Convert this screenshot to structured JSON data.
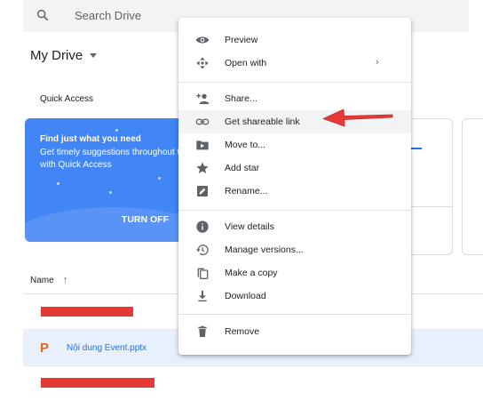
{
  "search": {
    "placeholder": "Search Drive"
  },
  "header": {
    "title": "My Drive"
  },
  "quick_access": {
    "label": "Quick Access",
    "card": {
      "title": "Find just what you need",
      "description": "Get timely suggestions throughout the day with Quick Access",
      "button": "TURN OFF"
    }
  },
  "file_list": {
    "column_name": "Name",
    "sort_icon": "↑",
    "files": [
      {
        "name": "",
        "redacted": true
      },
      {
        "name": "Nội dung Event.pptx",
        "icon": "powerpoint-icon"
      },
      {
        "name": "",
        "redacted": true
      }
    ]
  },
  "context_menu": {
    "items": [
      {
        "label": "Preview",
        "icon": "eye-icon"
      },
      {
        "label": "Open with",
        "icon": "move-arrows-icon",
        "submenu": true
      },
      {
        "label": "Share...",
        "icon": "add-person-icon"
      },
      {
        "label": "Get shareable link",
        "icon": "link-icon",
        "highlighted": true
      },
      {
        "label": "Move to...",
        "icon": "folder-move-icon"
      },
      {
        "label": "Add star",
        "icon": "star-icon"
      },
      {
        "label": "Rename...",
        "icon": "pencil-icon"
      },
      {
        "label": "View details",
        "icon": "info-icon"
      },
      {
        "label": "Manage versions...",
        "icon": "history-icon"
      },
      {
        "label": "Make a copy",
        "icon": "copy-icon"
      },
      {
        "label": "Download",
        "icon": "download-icon"
      },
      {
        "label": "Remove",
        "icon": "trash-icon"
      }
    ],
    "submenu_glyph": "›"
  },
  "colors": {
    "accent": "#1a73e8",
    "card_blue": "#4285f4",
    "annotation_arrow": "#e53935",
    "menu_highlight": "#f1f3f4",
    "selected_row": "#e8f0fe"
  }
}
